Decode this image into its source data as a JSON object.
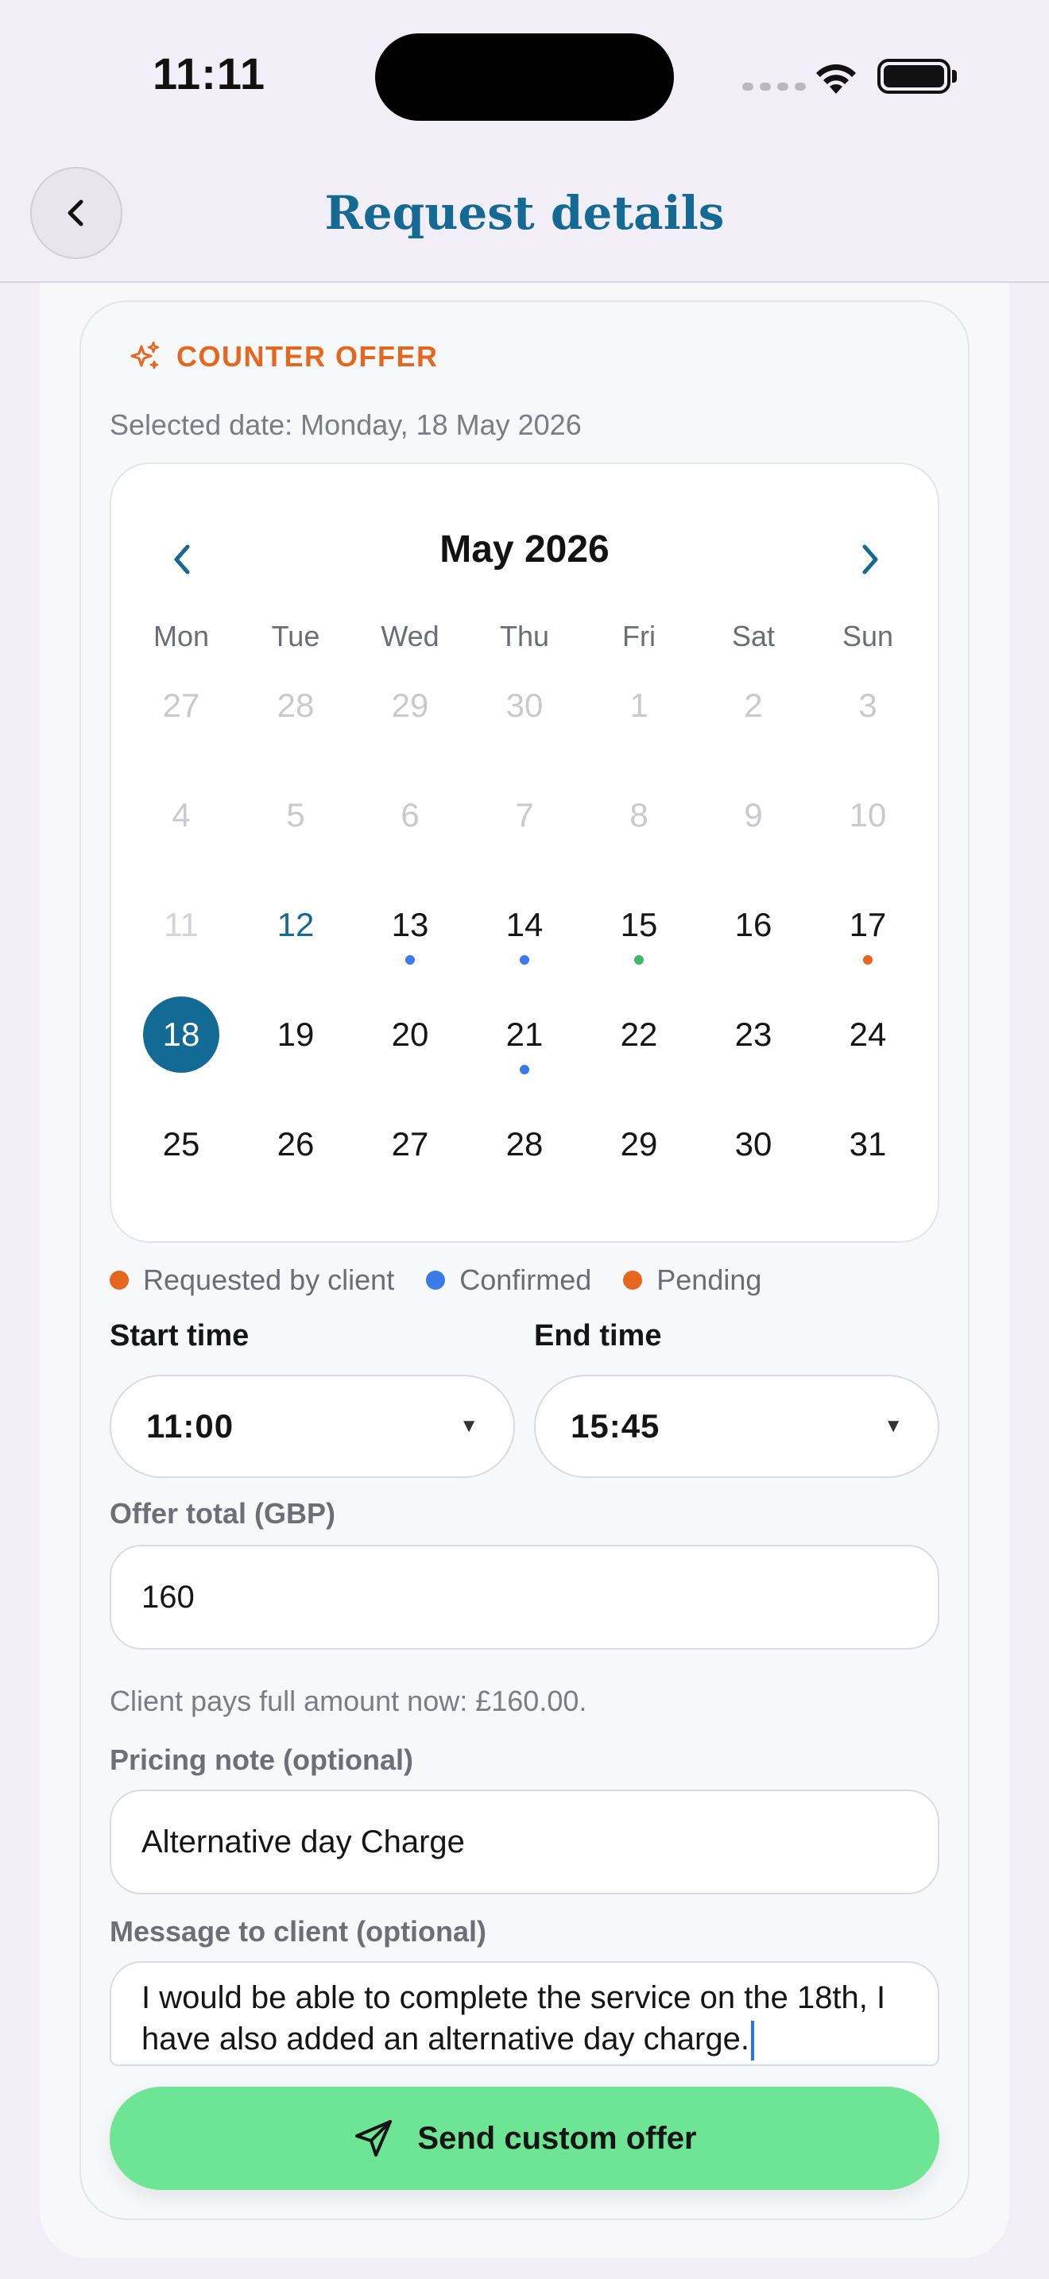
{
  "status_bar": {
    "time": "11:11"
  },
  "header": {
    "title": "Request details"
  },
  "counter_offer": {
    "label": "COUNTER OFFER",
    "selected_date": "Selected date: Monday, 18 May 2026"
  },
  "calendar": {
    "month": "May 2026",
    "weekdays": [
      "Mon",
      "Tue",
      "Wed",
      "Thu",
      "Fri",
      "Sat",
      "Sun"
    ],
    "weeks": [
      [
        {
          "d": "27",
          "s": "muted"
        },
        {
          "d": "28",
          "s": "muted"
        },
        {
          "d": "29",
          "s": "muted"
        },
        {
          "d": "30",
          "s": "muted"
        },
        {
          "d": "1",
          "s": "muted"
        },
        {
          "d": "2",
          "s": "muted"
        },
        {
          "d": "3",
          "s": "muted"
        }
      ],
      [
        {
          "d": "4",
          "s": "muted"
        },
        {
          "d": "5",
          "s": "muted"
        },
        {
          "d": "6",
          "s": "muted"
        },
        {
          "d": "7",
          "s": "muted"
        },
        {
          "d": "8",
          "s": "muted"
        },
        {
          "d": "9",
          "s": "muted"
        },
        {
          "d": "10",
          "s": "muted"
        }
      ],
      [
        {
          "d": "11",
          "s": "muted-strong"
        },
        {
          "d": "12",
          "s": "today"
        },
        {
          "d": "13",
          "s": "normal",
          "dot": "#3b7be8"
        },
        {
          "d": "14",
          "s": "normal",
          "dot": "#3b7be8"
        },
        {
          "d": "15",
          "s": "normal",
          "dot": "#3fb86a"
        },
        {
          "d": "16",
          "s": "normal"
        },
        {
          "d": "17",
          "s": "normal",
          "dot": "#e6661f"
        }
      ],
      [
        {
          "d": "18",
          "s": "selected"
        },
        {
          "d": "19",
          "s": "normal"
        },
        {
          "d": "20",
          "s": "normal"
        },
        {
          "d": "21",
          "s": "normal",
          "dot": "#3b7be8"
        },
        {
          "d": "22",
          "s": "normal"
        },
        {
          "d": "23",
          "s": "normal"
        },
        {
          "d": "24",
          "s": "normal"
        }
      ],
      [
        {
          "d": "25",
          "s": "normal"
        },
        {
          "d": "26",
          "s": "normal"
        },
        {
          "d": "27",
          "s": "normal"
        },
        {
          "d": "28",
          "s": "normal"
        },
        {
          "d": "29",
          "s": "normal"
        },
        {
          "d": "30",
          "s": "normal"
        },
        {
          "d": "31",
          "s": "normal"
        }
      ]
    ]
  },
  "legend": [
    {
      "label": "Requested by client",
      "color": "#e6661f"
    },
    {
      "label": "Confirmed",
      "color": "#3b7be8"
    },
    {
      "label": "Pending",
      "color": "#e6661f"
    }
  ],
  "form": {
    "start_label": "Start time",
    "start_value": "11:00",
    "end_label": "End time",
    "end_value": "15:45",
    "offer_label": "Offer total (GBP)",
    "offer_value": "160",
    "offer_hint": "Client pays full amount now: £160.00.",
    "pricing_label": "Pricing note (optional)",
    "pricing_value": "Alternative day Charge",
    "message_label": "Message to client (optional)",
    "message_value": "I would be able to complete the service on the 18th, I have also added an alternative day charge."
  },
  "actions": {
    "send_label": "Send custom offer"
  },
  "colors": {
    "accent": "#156a94",
    "orange": "#e6661f",
    "blue": "#3b7be8",
    "green": "#3fb86a",
    "send_bg": "#6ee594"
  }
}
